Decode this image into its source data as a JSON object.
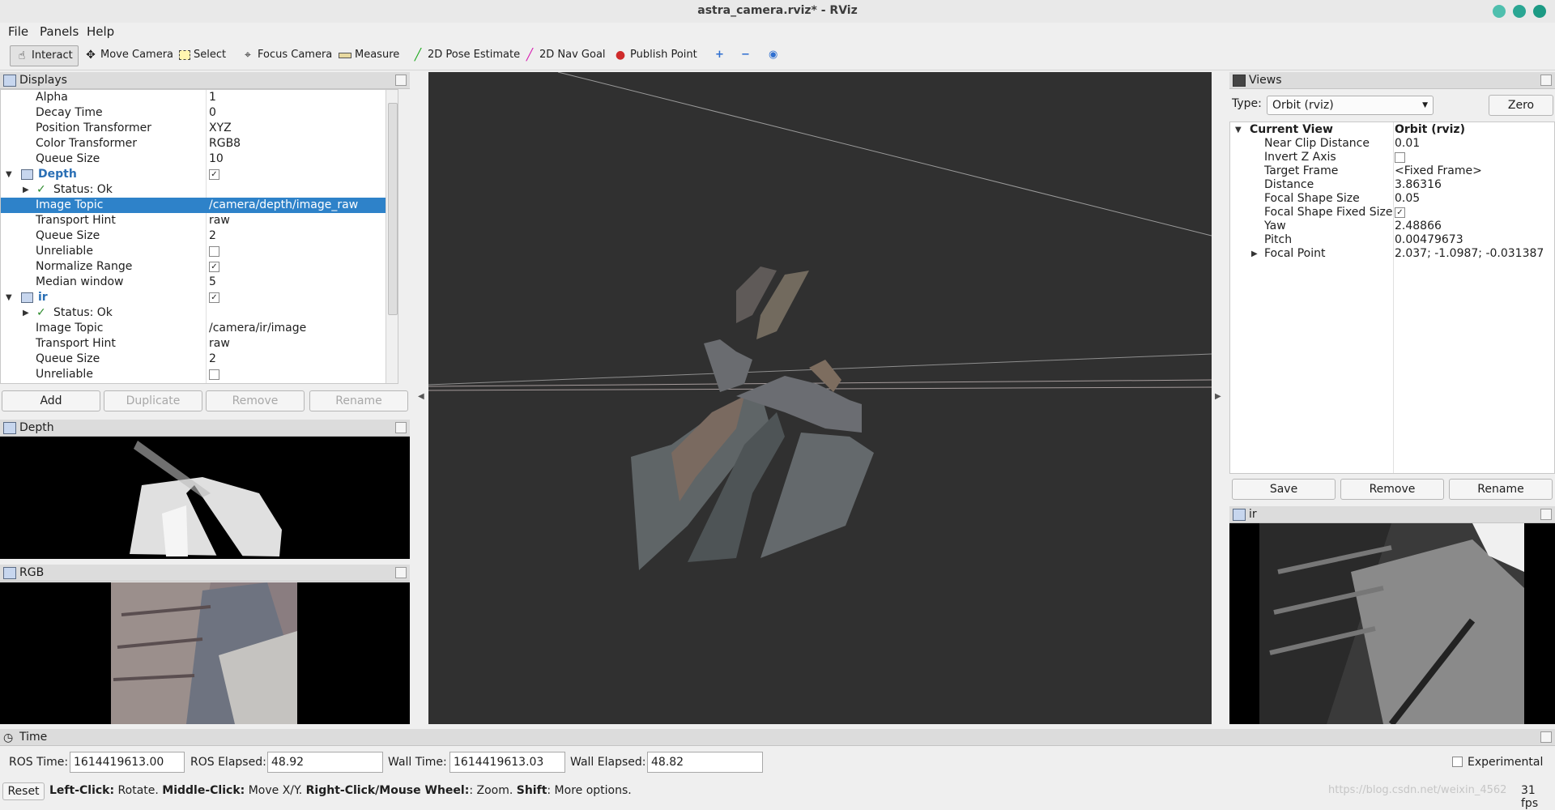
{
  "window": {
    "title": "astra_camera.rviz* - RViz"
  },
  "menu": [
    "File",
    "Panels",
    "Help"
  ],
  "toolbar": {
    "interact": "Interact",
    "move_camera": "Move Camera",
    "select": "Select",
    "focus_camera": "Focus Camera",
    "measure": "Measure",
    "pose_estimate": "2D Pose Estimate",
    "nav_goal": "2D Nav Goal",
    "publish_point": "Publish Point"
  },
  "displays": {
    "title": "Displays",
    "rows": [
      {
        "k": "Alpha",
        "v": "1"
      },
      {
        "k": "Decay Time",
        "v": "0"
      },
      {
        "k": "Position Transformer",
        "v": "XYZ"
      },
      {
        "k": "Color Transformer",
        "v": "RGB8"
      },
      {
        "k": "Queue Size",
        "v": "10"
      },
      {
        "k": "Depth",
        "v": ""
      },
      {
        "k": "Status: Ok",
        "v": ""
      },
      {
        "k": "Image Topic",
        "v": "/camera/depth/image_raw"
      },
      {
        "k": "Transport Hint",
        "v": "raw"
      },
      {
        "k": "Queue Size",
        "v": "2"
      },
      {
        "k": "Unreliable",
        "v": ""
      },
      {
        "k": "Normalize Range",
        "v": ""
      },
      {
        "k": "Median window",
        "v": "5"
      },
      {
        "k": "ir",
        "v": ""
      },
      {
        "k": "Status: Ok",
        "v": ""
      },
      {
        "k": "Image Topic",
        "v": "/camera/ir/image"
      },
      {
        "k": "Transport Hint",
        "v": "raw"
      },
      {
        "k": "Queue Size",
        "v": "2"
      },
      {
        "k": "Unreliable",
        "v": ""
      }
    ],
    "buttons": {
      "add": "Add",
      "duplicate": "Duplicate",
      "remove": "Remove",
      "rename": "Rename"
    }
  },
  "image_panels": {
    "depth": "Depth",
    "rgb": "RGB",
    "ir": "ir"
  },
  "views": {
    "title": "Views",
    "type_label": "Type:",
    "type_value": "Orbit (rviz)",
    "zero": "Zero",
    "rows": [
      {
        "k": "Current View",
        "v": "Orbit (rviz)"
      },
      {
        "k": "Near Clip Distance",
        "v": "0.01"
      },
      {
        "k": "Invert Z Axis",
        "v": ""
      },
      {
        "k": "Target Frame",
        "v": "<Fixed Frame>"
      },
      {
        "k": "Distance",
        "v": "3.86316"
      },
      {
        "k": "Focal Shape Size",
        "v": "0.05"
      },
      {
        "k": "Focal Shape Fixed Size",
        "v": ""
      },
      {
        "k": "Yaw",
        "v": "2.48866"
      },
      {
        "k": "Pitch",
        "v": "0.00479673"
      },
      {
        "k": "Focal Point",
        "v": "2.037; -1.0987; -0.031387"
      }
    ],
    "buttons": {
      "save": "Save",
      "remove": "Remove",
      "rename": "Rename"
    }
  },
  "time": {
    "title": "Time",
    "ros_time_label": "ROS Time:",
    "ros_time": "1614419613.00",
    "ros_elapsed_label": "ROS Elapsed:",
    "ros_elapsed": "48.92",
    "wall_time_label": "Wall Time:",
    "wall_time": "1614419613.03",
    "wall_elapsed_label": "Wall Elapsed:",
    "wall_elapsed": "48.82",
    "experimental": "Experimental"
  },
  "status": {
    "reset": "Reset",
    "lc": "Left-Click:",
    "lc_t": " Rotate. ",
    "mc": "Middle-Click:",
    "mc_t": " Move X/Y. ",
    "rc": "Right-Click/Mouse Wheel:",
    "rc_t": ": Zoom. ",
    "sh": "Shift",
    "sh_t": ": More options.",
    "watermark": "https://blog.csdn.net/weixin_4562",
    "fps": "31 fps"
  }
}
